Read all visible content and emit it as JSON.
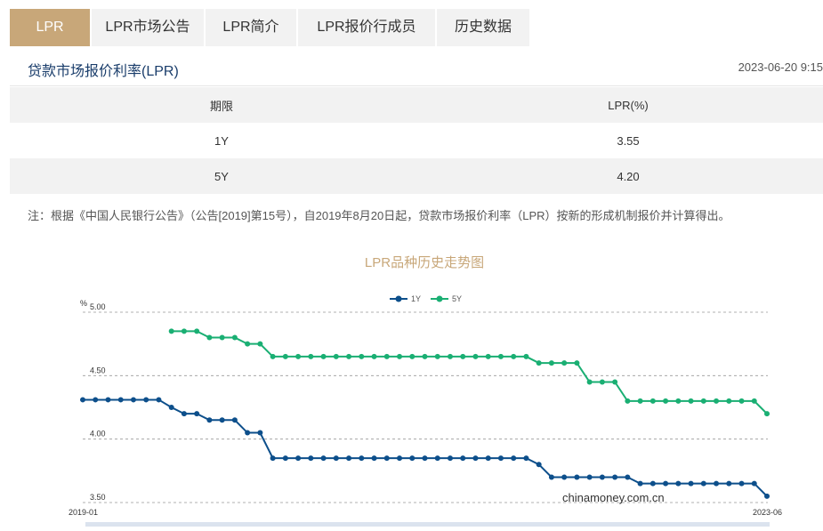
{
  "tabs": [
    {
      "label": "LPR",
      "active": true
    },
    {
      "label": "LPR市场公告",
      "active": false
    },
    {
      "label": "LPR简介",
      "active": false
    },
    {
      "label": "LPR报价行成员",
      "active": false
    },
    {
      "label": "历史数据",
      "active": false
    }
  ],
  "page_title": "贷款市场报价利率(LPR)",
  "timestamp": "2023-06-20 9:15",
  "table": {
    "headers": [
      "期限",
      "LPR(%)"
    ],
    "rows": [
      [
        "1Y",
        "3.55"
      ],
      [
        "5Y",
        "4.20"
      ]
    ]
  },
  "note": "注：根据《中国人民银行公告》（公告[2019]第15号），自2019年8月20日起，贷款市场报价利率（LPR）按新的形成机制报价并计算得出。",
  "watermark": "chinamoney.com.cn",
  "colors": {
    "accent": "#c8a779",
    "series_1y": "#0d4f8b",
    "series_5y": "#1aaf73",
    "title": "#1a3d6b"
  },
  "chart_data": {
    "type": "line",
    "title": "LPR品种历史走势图",
    "ylabel": "%",
    "ylim": [
      3.5,
      5.0
    ],
    "yticks": [
      "5.00",
      "4.50",
      "4.00",
      "3.50"
    ],
    "x_start_label": "2019-01",
    "x_end_label": "2023-06",
    "legend": "top-center",
    "grid": true,
    "series": [
      {
        "name": "1Y",
        "values": [
          4.31,
          4.31,
          4.31,
          4.31,
          4.31,
          4.31,
          4.31,
          4.25,
          4.2,
          4.2,
          4.15,
          4.15,
          4.15,
          4.05,
          4.05,
          3.85,
          3.85,
          3.85,
          3.85,
          3.85,
          3.85,
          3.85,
          3.85,
          3.85,
          3.85,
          3.85,
          3.85,
          3.85,
          3.85,
          3.85,
          3.85,
          3.85,
          3.85,
          3.85,
          3.85,
          3.85,
          3.8,
          3.7,
          3.7,
          3.7,
          3.7,
          3.7,
          3.7,
          3.7,
          3.65,
          3.65,
          3.65,
          3.65,
          3.65,
          3.65,
          3.65,
          3.65,
          3.65,
          3.65,
          3.55
        ]
      },
      {
        "name": "5Y",
        "values": [
          null,
          null,
          null,
          null,
          null,
          null,
          null,
          4.85,
          4.85,
          4.85,
          4.8,
          4.8,
          4.8,
          4.75,
          4.75,
          4.65,
          4.65,
          4.65,
          4.65,
          4.65,
          4.65,
          4.65,
          4.65,
          4.65,
          4.65,
          4.65,
          4.65,
          4.65,
          4.65,
          4.65,
          4.65,
          4.65,
          4.65,
          4.65,
          4.65,
          4.65,
          4.6,
          4.6,
          4.6,
          4.6,
          4.45,
          4.45,
          4.45,
          4.3,
          4.3,
          4.3,
          4.3,
          4.3,
          4.3,
          4.3,
          4.3,
          4.3,
          4.3,
          4.3,
          4.2
        ]
      }
    ]
  }
}
